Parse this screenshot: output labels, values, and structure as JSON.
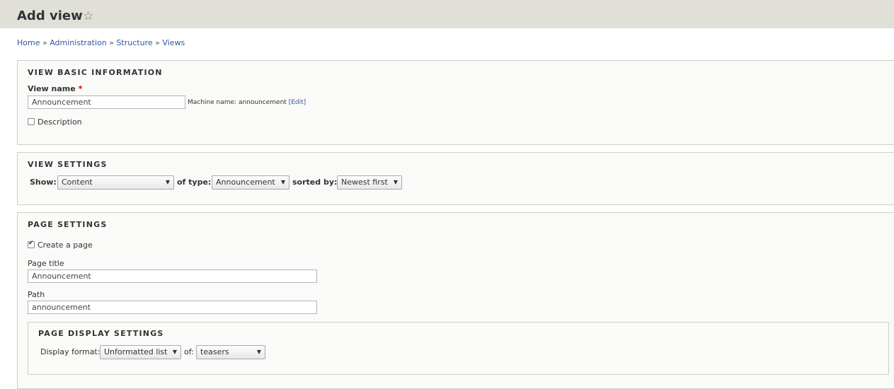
{
  "header": {
    "title": "Add view",
    "star_icon": "star-outline-icon"
  },
  "breadcrumb": [
    "Home",
    "Administration",
    "Structure",
    "Views"
  ],
  "breadcrumb_separator": "»",
  "basic_info": {
    "legend": "VIEW BASIC INFORMATION",
    "view_name_label": "View name",
    "required_marker": "*",
    "view_name_value": "Announcement",
    "machine_name_text": "Machine name: announcement",
    "machine_name_edit": "[Edit]",
    "description_label": "Description",
    "description_checked": false
  },
  "view_settings": {
    "legend": "VIEW SETTINGS",
    "show_label": "Show:",
    "show_value": "Content",
    "type_label": "of type:",
    "type_value": "Announcement",
    "sorted_label": "sorted by:",
    "sorted_value": "Newest first"
  },
  "page_settings": {
    "legend": "PAGE SETTINGS",
    "create_page_label": "Create a page",
    "create_page_checked": true,
    "page_title_label": "Page title",
    "page_title_value": "Announcement",
    "path_label": "Path",
    "path_value": "announcement",
    "display": {
      "legend": "PAGE DISPLAY SETTINGS",
      "format_label": "Display format:",
      "format_value": "Unformatted list",
      "of_label": "of:",
      "of_value": "teasers"
    }
  },
  "arrow_glyph": "▼"
}
